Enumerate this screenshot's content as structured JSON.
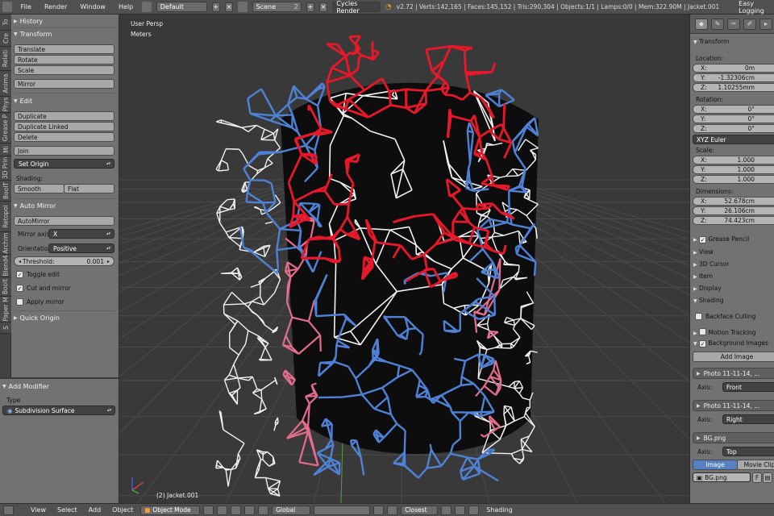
{
  "topbar": {
    "menu": [
      "File",
      "Render",
      "Window",
      "Help"
    ],
    "layout": "Default",
    "scene": "Scene",
    "scene_users": "2",
    "render_engine": "Cycles Render",
    "stats": "v2.72 | Verts:142,165 | Faces:145,152 | Tris:290,304 | Objects:1/1 | Lamps:0/0 | Mem:322.90M | Jacket.001",
    "easy_logging": "Easy Logging"
  },
  "vtabs": [
    "To",
    "Cre",
    "Relati",
    "Anima",
    "Phys",
    "Grease P",
    "Mi",
    "3D Prin",
    "BoolT",
    "Retopol",
    "Archim",
    "Blend4",
    "Boolt",
    "Paper M",
    "S"
  ],
  "tools": {
    "history": "History",
    "transform": {
      "title": "Transform",
      "buttons": [
        "Translate",
        "Rotate",
        "Scale"
      ],
      "mirror": "Mirror"
    },
    "edit": {
      "title": "Edit",
      "buttons": [
        "Duplicate",
        "Duplicate Linked",
        "Delete"
      ],
      "join": "Join",
      "set_origin": "Set Origin",
      "shading_label": "Shading:",
      "smooth": "Smooth",
      "flat": "Flat"
    },
    "auto_mirror": {
      "title": "Auto Mirror",
      "button": "AutoMirror",
      "mirror_axis_label": "Mirror axis",
      "mirror_axis": "X",
      "orientation_label": "Orientatio",
      "orientation": "Positive",
      "threshold_label": "Threshold:",
      "threshold": "0.001",
      "toggle_edit": "Toggle edit",
      "cut_and_mirror": "Cut and mirror",
      "apply_mirror": "Apply mirror"
    },
    "quick_origin": "Quick Origin"
  },
  "modifier": {
    "title": "Add Modifier",
    "type_label": "Type",
    "type": "Subdivision Surface"
  },
  "viewport": {
    "view": "User Persp",
    "units": "Meters",
    "object": "(2) Jacket.001"
  },
  "props": {
    "transform_title": "Transform",
    "location_label": "Location:",
    "location": [
      {
        "axis": "X:",
        "value": "0m"
      },
      {
        "axis": "Y:",
        "value": "-1.32306cm"
      },
      {
        "axis": "Z:",
        "value": "1.10255mm"
      }
    ],
    "rotation_label": "Rotation:",
    "rotation": [
      {
        "axis": "X:",
        "value": "0°"
      },
      {
        "axis": "Y:",
        "value": "0°"
      },
      {
        "axis": "Z:",
        "value": "0°"
      }
    ],
    "rotation_mode": "XYZ Euler",
    "scale_label": "Scale:",
    "scale": [
      {
        "axis": "X:",
        "value": "1.000"
      },
      {
        "axis": "Y:",
        "value": "1.000"
      },
      {
        "axis": "Z:",
        "value": "1.000"
      }
    ],
    "dimensions_label": "Dimensions:",
    "dimensions": [
      {
        "axis": "X:",
        "value": "52.678cm"
      },
      {
        "axis": "Y:",
        "value": "26.106cm"
      },
      {
        "axis": "Z:",
        "value": "74.423cm"
      }
    ],
    "sections": [
      "Grease Pencil",
      "View",
      "3D Cursor",
      "Item",
      "Display"
    ],
    "shading": "Shading",
    "backface_culling": "Backface Culling",
    "motion_tracking": "Motion Tracking",
    "background_images": "Background Images",
    "add_image": "Add Image",
    "bg_images": [
      {
        "name": "Photo 11-11-14, ...",
        "axis_label": "Axis:",
        "axis": "Front"
      },
      {
        "name": "Photo 11-11-14, ...",
        "axis_label": "Axis:",
        "axis": "Right"
      },
      {
        "name": "BG.png",
        "axis_label": "Axis:",
        "axis": "Top"
      }
    ],
    "image_tab": "Image",
    "movie_clip_tab": "Movie Clip",
    "bg_file": "BG.png",
    "bg_file_flag": "F"
  },
  "bottombar": {
    "menu": [
      "View",
      "Select",
      "Add",
      "Object"
    ],
    "mode": "Object Mode",
    "orientation": "Global",
    "snap": "Closest",
    "layer_name": "Shading"
  },
  "colors": {
    "red": "#e8182a",
    "blue": "#4f82d6",
    "white": "#f2f2f2",
    "pink": "#e46c8c",
    "grid": "#4a4a4a"
  }
}
